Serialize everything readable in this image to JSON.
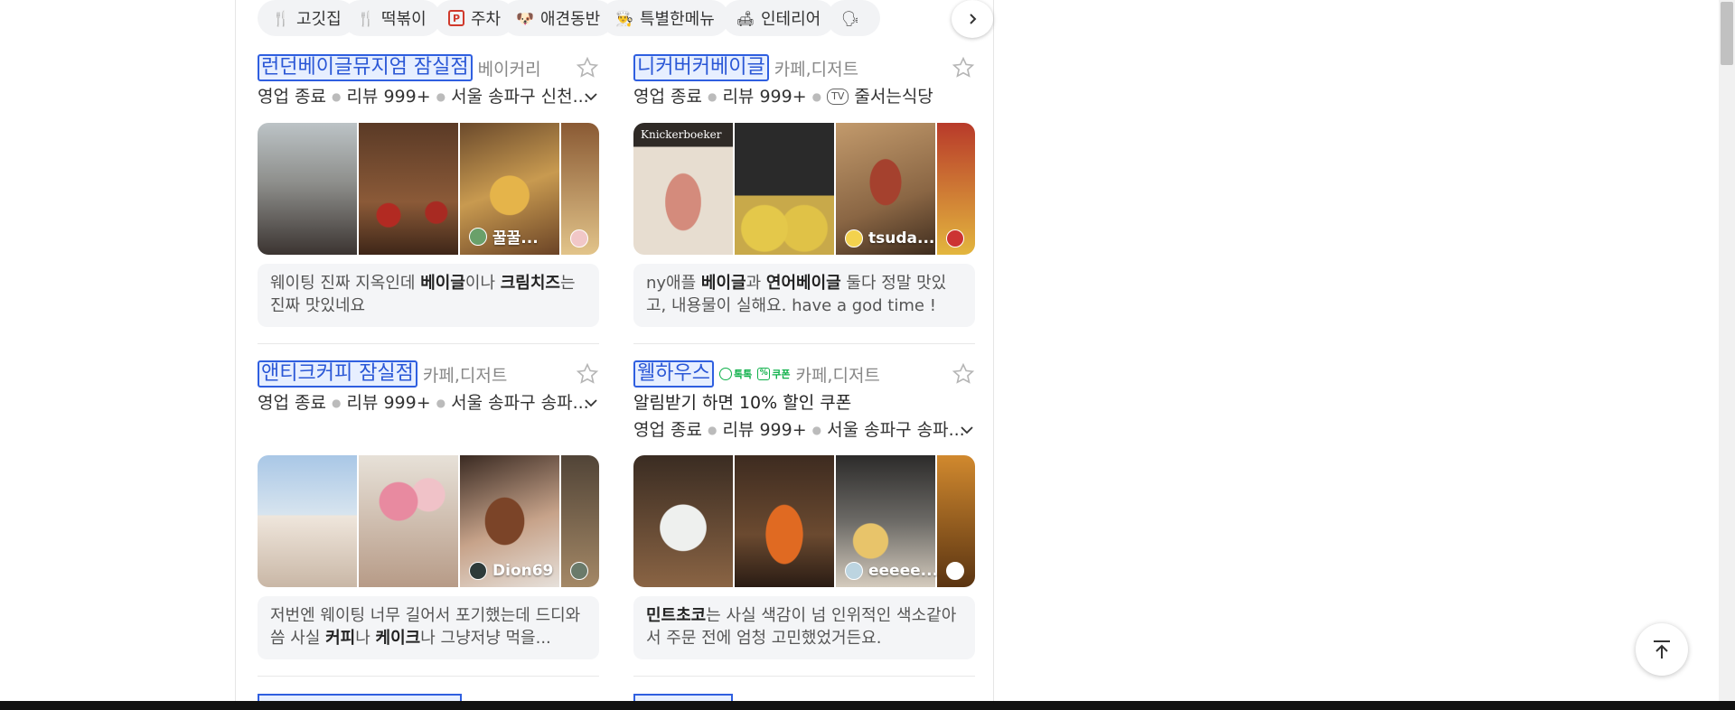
{
  "chips": [
    {
      "icon": "fork-knife-icon",
      "glyph": "🍴",
      "label": "고깃집"
    },
    {
      "icon": "fork-knife-icon",
      "glyph": "🍴",
      "label": "떡볶이"
    },
    {
      "icon": "parking-icon",
      "glyph": "P",
      "label": "주차"
    },
    {
      "icon": "dog-icon",
      "glyph": "🐶",
      "label": "애견동반"
    },
    {
      "icon": "chef-icon",
      "glyph": "👨‍🍳",
      "label": "특별한메뉴"
    },
    {
      "icon": "sofa-icon",
      "glyph": "🛋",
      "label": "인테리어"
    },
    {
      "icon": "person-icon",
      "glyph": "🗣",
      "label": ""
    }
  ],
  "cards": [
    {
      "name": "런던베이글뮤지엄 잠실점",
      "category": "베이커리",
      "status": "영업 종료",
      "reviews": "리뷰 999+",
      "extra": "서울 송파구 신천...",
      "photo_user": "꿀꿀...",
      "review_parts": [
        "웨이팅 진짜 지옥인데 ",
        "베이글",
        "이나 ",
        "크림치즈",
        "는 진짜 맛있네요"
      ]
    },
    {
      "name": "니커버커베이글",
      "category": "카페,디저트",
      "status": "영업 종료",
      "reviews": "리뷰 999+",
      "tv_label": "TV",
      "extra": "줄서는식당",
      "photo_label": "Knickerboeker",
      "photo_user": "tsuda...",
      "review_parts": [
        "ny애플 ",
        "베이글",
        "과 ",
        "연어베이글",
        " 둘다 정말 맛있고, 내용물이 실해요. have a god time !"
      ]
    },
    {
      "name": "앤티크커피 잠실점",
      "category": "카페,디저트",
      "status": "영업 종료",
      "reviews": "리뷰 999+",
      "extra": "서울 송파구 송파...",
      "photo_user": "Dion69",
      "review_parts": [
        "저번엔 웨이팅 너무 길어서 포기했는데 드디와씀 사실 ",
        "커피",
        "나 ",
        "케이크",
        "나 그냥저냥 먹을..."
      ]
    },
    {
      "name": "웰하우스",
      "category": "카페,디저트",
      "badge_talk": "톡톡",
      "badge_coupon": "쿠폰",
      "coupon_text": "알림받기 하면 10% 할인 쿠폰",
      "status": "영업 종료",
      "reviews": "리뷰 999+",
      "extra": "서울 송파구 송파...",
      "photo_user": "eeeee...",
      "review_parts": [
        "민트초코",
        "는 사실 색감이 넘 인위적인 색소같아서 주문 전에 엄청 고민했었거든요.",
        ""
      ]
    }
  ],
  "colors": {
    "accent": "#2a57d6",
    "highlight_bg": "#e7efff",
    "badge_green": "#10b14b",
    "review_bg": "#f4f5f7"
  }
}
